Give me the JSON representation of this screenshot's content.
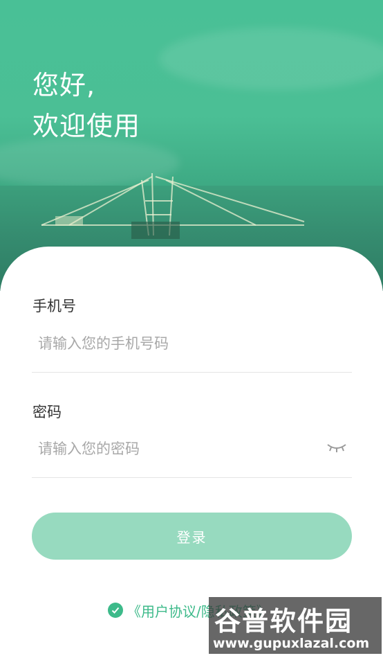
{
  "greeting": {
    "line1": "您好,",
    "line2": "欢迎使用"
  },
  "phone": {
    "label": "手机号",
    "placeholder": "请输入您的手机号码",
    "value": ""
  },
  "password": {
    "label": "密码",
    "placeholder": "请输入您的密码",
    "value": "",
    "visibility_icon": "eye-closed-icon"
  },
  "login": {
    "label": "登录"
  },
  "agreement": {
    "text": "《用户协议/隐私政策》",
    "checked": true
  },
  "watermark": {
    "title": "谷普软件园",
    "url": "www.gupuxlazal.com"
  },
  "colors": {
    "primary": "#3dba8a",
    "button": "#97dabf"
  }
}
